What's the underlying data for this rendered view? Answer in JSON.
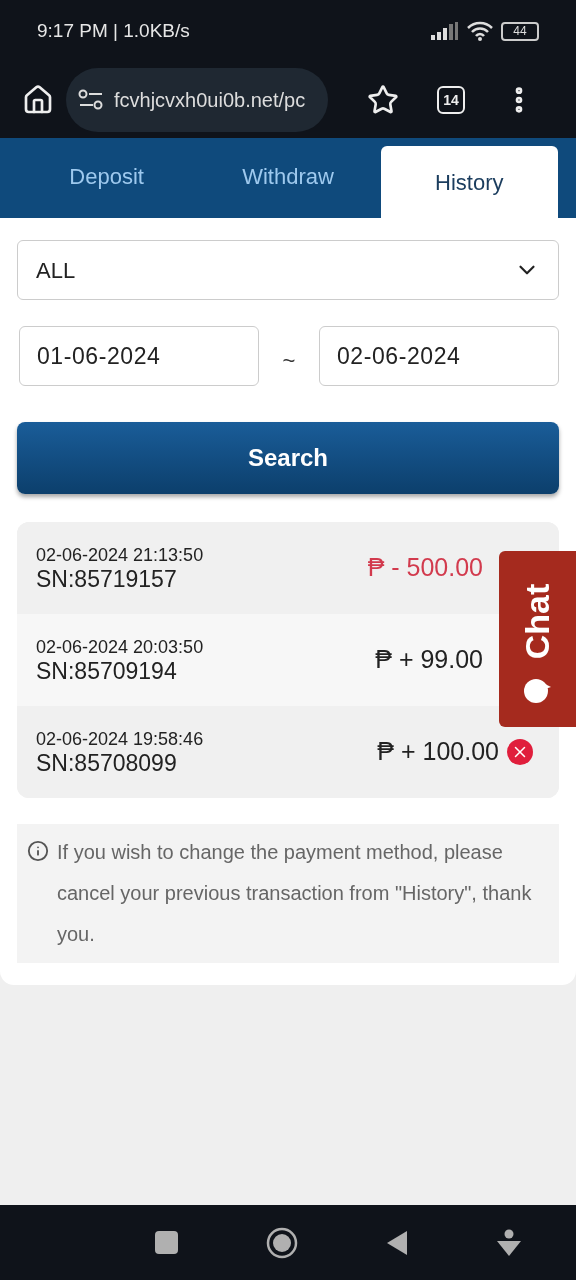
{
  "status_bar": {
    "time": "9:17 PM | 1.0KB/s",
    "battery": "44"
  },
  "browser": {
    "url": "fcvhjcvxh0ui0b.net/pc",
    "tab_count": "14"
  },
  "tabs": [
    {
      "label": "Deposit",
      "selected": false
    },
    {
      "label": "Withdraw",
      "selected": false
    },
    {
      "label": "History",
      "selected": true
    }
  ],
  "filter": {
    "value": "ALL"
  },
  "date_from": {
    "value": "01-06-2024"
  },
  "date_separator": "~",
  "date_to": {
    "value": "02-06-2024"
  },
  "search_button": "Search",
  "transactions": [
    {
      "datetime": "02-06-2024 21:13:50",
      "sn": "SN:85719157",
      "amount": "₱ - 500.00",
      "kind": "debit",
      "cancellable": false
    },
    {
      "datetime": "02-06-2024 20:03:50",
      "sn": "SN:85709194",
      "amount": "₱ + 99.00",
      "kind": "credit",
      "cancellable": false
    },
    {
      "datetime": "02-06-2024 19:58:46",
      "sn": "SN:85708099",
      "amount": "₱ + 100.00",
      "kind": "credit",
      "cancellable": true
    }
  ],
  "notice": "If you wish to change the payment method, please cancel your previous transaction from \"History\", thank you.",
  "chat_button": "Chat"
}
